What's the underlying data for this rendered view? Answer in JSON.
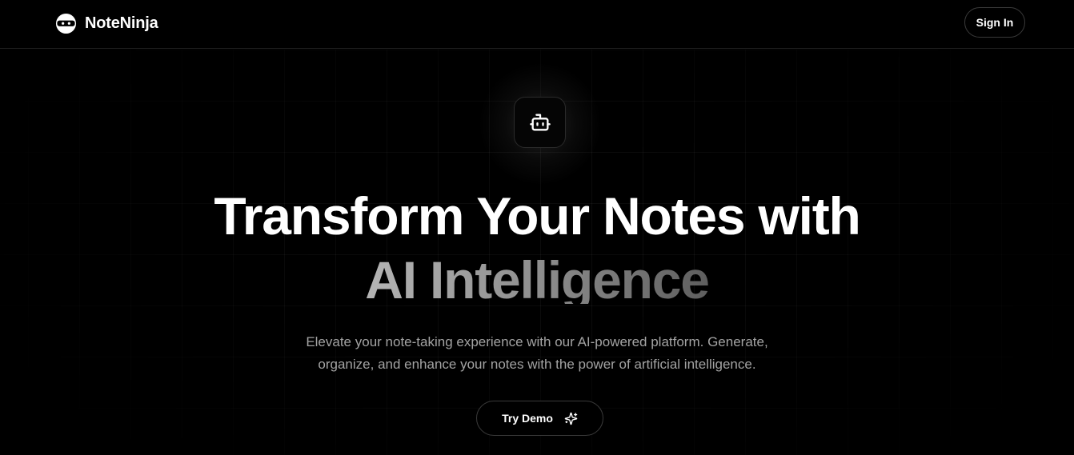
{
  "header": {
    "brand_name": "NoteNinja",
    "brand_icon": "ninja-logo-icon",
    "signin_label": "Sign In"
  },
  "hero": {
    "icon": "robot-icon",
    "headline_line1": "Transform Your Notes with",
    "headline_line2": "AI Intelligence",
    "subtitle_line1": "Elevate your note-taking experience with our AI-powered platform. Generate,",
    "subtitle_line2": "organize, and enhance your notes with the power of artificial intelligence.",
    "cta_label": "Try Demo",
    "cta_icon": "sparkles-icon"
  },
  "colors": {
    "background": "#000000",
    "text_primary": "#ffffff",
    "text_muted": "#a3a3a3",
    "border": "#3a3a3a"
  }
}
